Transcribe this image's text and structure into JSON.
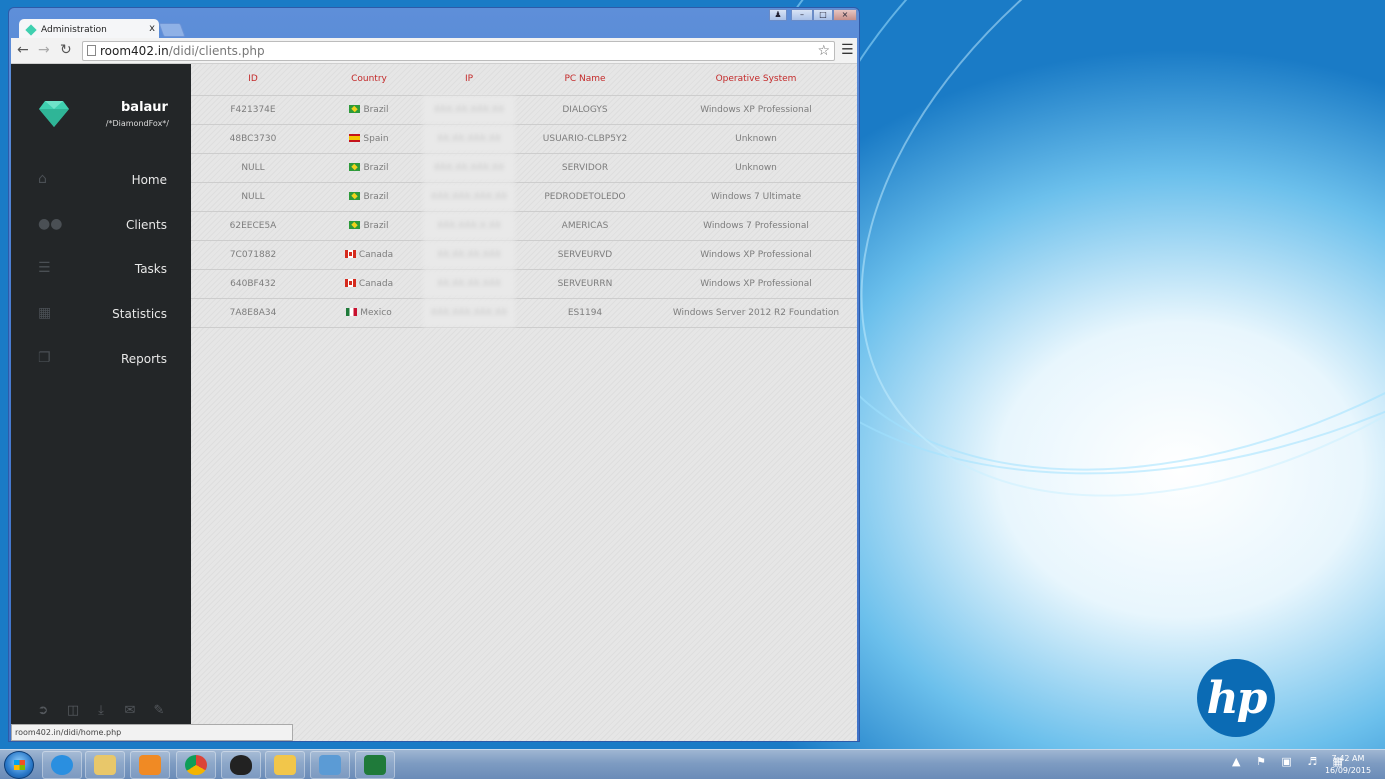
{
  "browser": {
    "tab_title": "Administration",
    "tab_close": "x",
    "url_host": "room402.in",
    "url_path": "/didi/clients.php",
    "status_url": "room402.in/didi/home.php"
  },
  "sidebar": {
    "brand_name": "balaur",
    "brand_sub": "/*DiamondFox*/",
    "items": [
      {
        "label": "Home",
        "icon": "home-icon"
      },
      {
        "label": "Clients",
        "icon": "users-icon"
      },
      {
        "label": "Tasks",
        "icon": "tasks-icon"
      },
      {
        "label": "Statistics",
        "icon": "grid-icon"
      },
      {
        "label": "Reports",
        "icon": "reports-icon"
      }
    ],
    "footer_icons": [
      "logout-icon",
      "trash-icon",
      "download-icon",
      "mail-icon",
      "edit-icon"
    ]
  },
  "table": {
    "headers": {
      "id": "ID",
      "country": "Country",
      "ip": "IP",
      "pc": "PC Name",
      "os": "Operative System"
    },
    "rows": [
      {
        "id": "F421374E",
        "country": "Brazil",
        "flag": "brazil",
        "ip": "XXX.XX.XXX.XX",
        "pc": "DIALOGYS",
        "os": "Windows XP Professional"
      },
      {
        "id": "48BC3730",
        "country": "Spain",
        "flag": "spain",
        "ip": "XX.XX.XXX.XX",
        "pc": "USUARIO-CLBP5Y2",
        "os": "Unknown"
      },
      {
        "id": "NULL",
        "country": "Brazil",
        "flag": "brazil",
        "ip": "XXX.XX.XXX.XX",
        "pc": "SERVIDOR",
        "os": "Unknown"
      },
      {
        "id": "NULL",
        "country": "Brazil",
        "flag": "brazil",
        "ip": "XXX.XXX.XXX.XX",
        "pc": "PEDRODETOLEDO",
        "os": "Windows 7 Ultimate"
      },
      {
        "id": "62EECE5A",
        "country": "Brazil",
        "flag": "brazil",
        "ip": "XXX.XXX.X.XX",
        "pc": "AMERICAS",
        "os": "Windows 7 Professional"
      },
      {
        "id": "7C071882",
        "country": "Canada",
        "flag": "canada",
        "ip": "XX.XX.XX.XXX",
        "pc": "SERVEURVD",
        "os": "Windows XP Professional"
      },
      {
        "id": "640BF432",
        "country": "Canada",
        "flag": "canada",
        "ip": "XX.XX.XX.XXX",
        "pc": "SERVEURRN",
        "os": "Windows XP Professional"
      },
      {
        "id": "7A8E8A34",
        "country": "Mexico",
        "flag": "mexico",
        "ip": "XXX.XXX.XXX.XX",
        "pc": "ES1194",
        "os": "Windows Server 2012 R2 Foundation"
      }
    ]
  },
  "desktop": {
    "logo_text": "hp"
  },
  "taskbar": {
    "items": [
      "internet-explorer-icon",
      "file-explorer-icon",
      "media-player-icon",
      "chrome-icon",
      "penguin-app-icon",
      "mail-app-icon",
      "remote-desktop-icon",
      "excel-icon"
    ],
    "time": "7:42 AM",
    "date": "16/09/2015"
  },
  "colors": {
    "sidebar_bg": "#232628",
    "header_red": "#c42a2a",
    "gem": "#3fd0b0"
  }
}
